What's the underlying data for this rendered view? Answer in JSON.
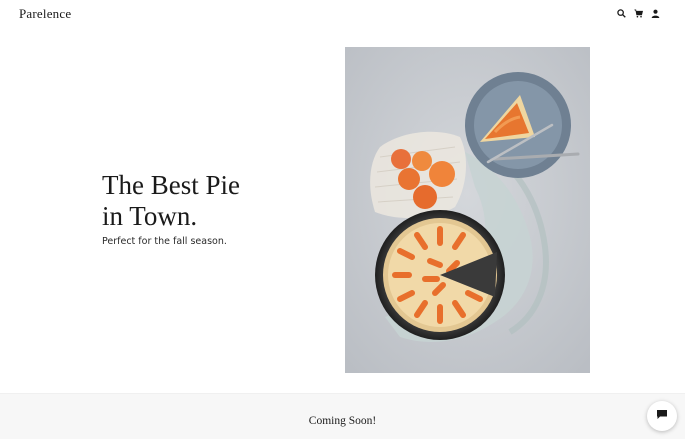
{
  "header": {
    "brand": "Parelence",
    "icons": [
      "search-icon",
      "cart-icon",
      "account-icon"
    ]
  },
  "hero": {
    "title_line1": "The Best Pie",
    "title_line2": "in Town.",
    "subtitle": "Perfect for the fall season.",
    "image": "apricot-tart-photo"
  },
  "footer": {
    "announcement": "Coming Soon!",
    "chat_icon": "chat-icon"
  },
  "colors": {
    "background": "#ffffff",
    "text": "#1a1a1a",
    "footer_bg": "#f7f7f7",
    "photo_bg": "#c9ccd1",
    "plate": "#7d8ea1",
    "apricot": "#e86f2c",
    "crust": "#f1d9a8"
  }
}
